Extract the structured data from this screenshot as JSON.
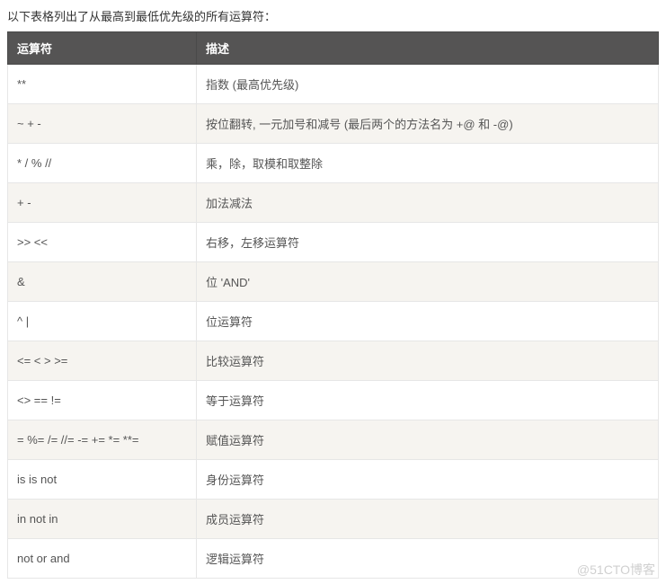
{
  "intro": "以下表格列出了从最高到最低优先级的所有运算符：",
  "headers": {
    "operator": "运算符",
    "description": "描述"
  },
  "rows": [
    {
      "operator": "**",
      "description": "指数 (最高优先级)"
    },
    {
      "operator": "~ + -",
      "description": "按位翻转, 一元加号和减号 (最后两个的方法名为 +@ 和 -@)"
    },
    {
      "operator": "* / % //",
      "description": "乘，除，取模和取整除"
    },
    {
      "operator": "+ -",
      "description": "加法减法"
    },
    {
      "operator": ">> <<",
      "description": "右移，左移运算符"
    },
    {
      "operator": "&",
      "description": "位 'AND'"
    },
    {
      "operator": "^ |",
      "description": "位运算符"
    },
    {
      "operator": "<= < > >=",
      "description": "比较运算符"
    },
    {
      "operator": "<> == !=",
      "description": "等于运算符"
    },
    {
      "operator": "= %= /= //= -= += *= **=",
      "description": "赋值运算符"
    },
    {
      "operator": "is is not",
      "description": "身份运算符"
    },
    {
      "operator": "in not in",
      "description": "成员运算符"
    },
    {
      "operator": "not or and",
      "description": "逻辑运算符"
    }
  ],
  "watermark": "@51CTO博客"
}
